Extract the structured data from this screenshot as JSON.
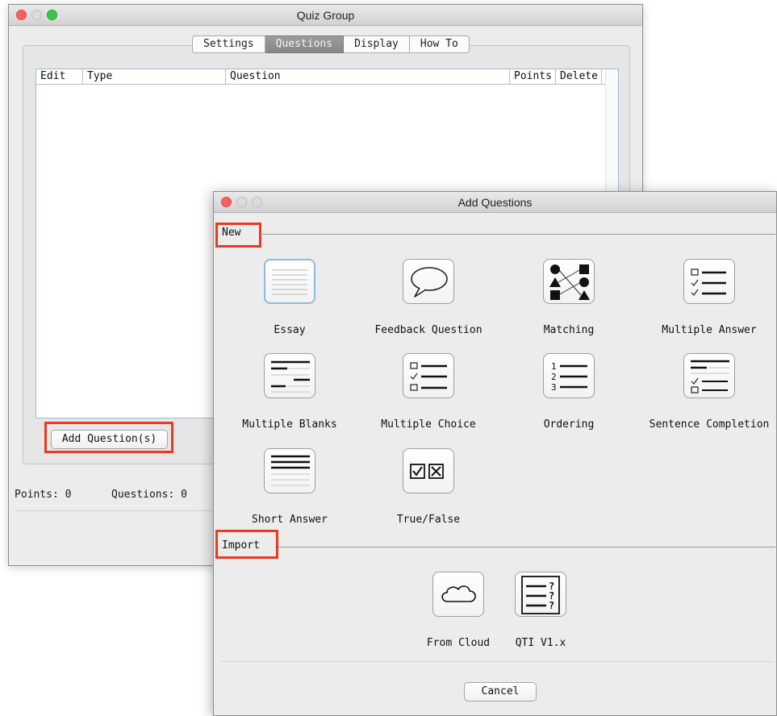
{
  "quiz_window": {
    "title": "Quiz Group",
    "tabs": [
      {
        "label": "Settings",
        "active": false
      },
      {
        "label": "Questions",
        "active": true
      },
      {
        "label": "Display",
        "active": false
      },
      {
        "label": "How To",
        "active": false
      }
    ],
    "table_columns": [
      "Edit",
      "Type",
      "Question",
      "Points",
      "Delete"
    ],
    "add_button_label": "Add Question(s)",
    "points_label": "Points: 0",
    "questions_label": "Questions: 0"
  },
  "add_window": {
    "title": "Add Questions",
    "new_section_label": "New",
    "import_section_label": "Import",
    "new_items": [
      {
        "label": "Essay",
        "icon": "essay-icon"
      },
      {
        "label": "Feedback Question",
        "icon": "speech-bubble-icon"
      },
      {
        "label": "Matching",
        "icon": "matching-shapes-icon"
      },
      {
        "label": "Multiple Answer",
        "icon": "multiple-answer-icon"
      },
      {
        "label": "Multiple Blanks",
        "icon": "multiple-blanks-icon"
      },
      {
        "label": "Multiple Choice",
        "icon": "multiple-choice-icon"
      },
      {
        "label": "Ordering",
        "icon": "ordering-icon"
      },
      {
        "label": "Sentence Completion",
        "icon": "sentence-completion-icon"
      },
      {
        "label": "Short Answer",
        "icon": "short-answer-icon"
      },
      {
        "label": "True/False",
        "icon": "true-false-icon"
      }
    ],
    "import_items": [
      {
        "label": "From Cloud",
        "icon": "cloud-icon"
      },
      {
        "label": "QTI V1.x",
        "icon": "qti-document-icon"
      }
    ],
    "cancel_label": "Cancel"
  },
  "colors": {
    "highlight_box": "#ec3a1f",
    "selected_icon_border": "#8fb8e6",
    "close_light": "#fc605c",
    "zoom_light": "#34c84a"
  }
}
